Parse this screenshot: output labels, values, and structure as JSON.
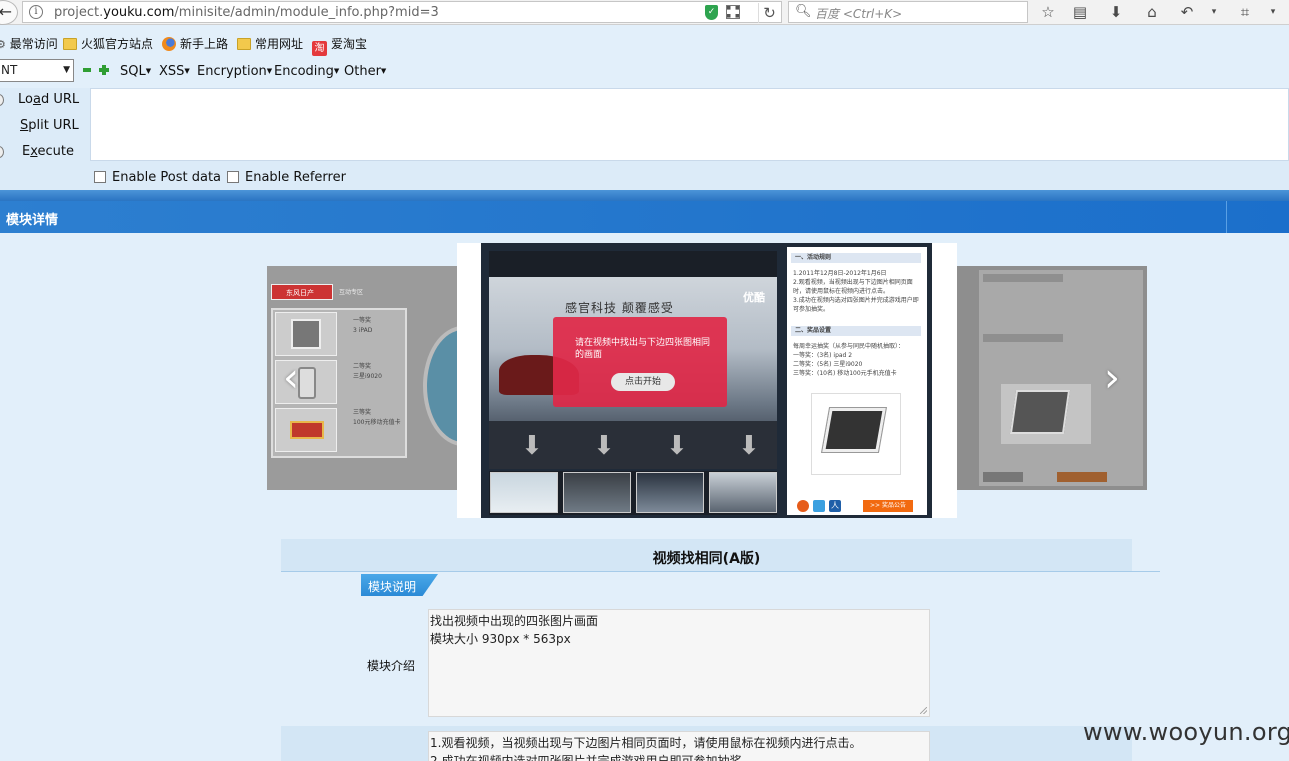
{
  "browser": {
    "url_prefix": "project.",
    "url_domain": "youku.com",
    "url_path": "/minisite/admin/module_info.php?mid=3",
    "search_placeholder": "百度 <Ctrl+K>"
  },
  "bookmarks": [
    {
      "label": "最常访问",
      "icon": "gear-icon"
    },
    {
      "label": "火狐官方站点",
      "icon": "folder-icon"
    },
    {
      "label": "新手上路",
      "icon": "firefox-icon"
    },
    {
      "label": "常用网址",
      "icon": "folder-icon"
    },
    {
      "label": "爱淘宝",
      "icon": "taobao-icon",
      "icon_text": "淘"
    }
  ],
  "hackbar": {
    "select_value": "NT",
    "menus": [
      "SQL",
      "XSS",
      "Encryption",
      "Encoding",
      "Other"
    ],
    "actions": [
      {
        "pre": "Lo",
        "u": "a",
        "post": "d URL"
      },
      {
        "pre": "",
        "u": "S",
        "post": "plit URL"
      },
      {
        "pre": "E",
        "u": "x",
        "post": "ecute"
      }
    ],
    "checkbox_post": "Enable Post data",
    "checkbox_referrer": "Enable Referrer"
  },
  "page": {
    "title": "模块详情",
    "module_name": "视频找相同(A版)",
    "tag_label": "模块说明",
    "intro_label": "模块介绍",
    "intro_text_line1": "找出视频中出现的四张图片画面",
    "intro_text_line2": "模块大小 930px * 563px",
    "rules_line1": "1.观看视频，当视频出现与下边图片相同页面时，请使用鼠标在视频内进行点击。",
    "rules_line2": "2.成功在视频内选对四张图片并完成游戏用户即可参加抽奖。"
  },
  "preview": {
    "video_slogan": "感官科技  颠覆感受",
    "video_brand": "优酷",
    "popup_text": "请在视频中找出与下边四张图相同的画面",
    "popup_button": "点击开始",
    "panel_rules_title": "一、活动规则",
    "panel_rules_lines": [
      "1.2011年12月8日-2012年1月6日",
      "2.观看视频，当视频出现与下边图片相同页面",
      "时，请使用鼠标在视频内进行点击。",
      "3.成功在视频内选对四张图片并完成游戏用户即",
      "可参加抽奖。"
    ],
    "panel_prize_title": "二、奖品设置",
    "panel_prize_lines": [
      "每周幸运抽奖（从参与同民中随机抽取）：",
      "一等奖：(3名) ipad 2",
      "二等奖：(5名) 三星i9020",
      "三等奖：(10名) 移动100元手机充值卡"
    ],
    "panel_announce": ">> 奖品公告",
    "left_brand": "东风日产",
    "left_zone": "互动专区",
    "left_prizes": [
      {
        "rank": "一等奖",
        "item": "3 iPAD"
      },
      {
        "rank": "二等奖",
        "item": "三星i9020"
      },
      {
        "rank": "三等奖",
        "item": "100元移动充值卡"
      }
    ]
  },
  "watermark": "www.wooyun.org"
}
